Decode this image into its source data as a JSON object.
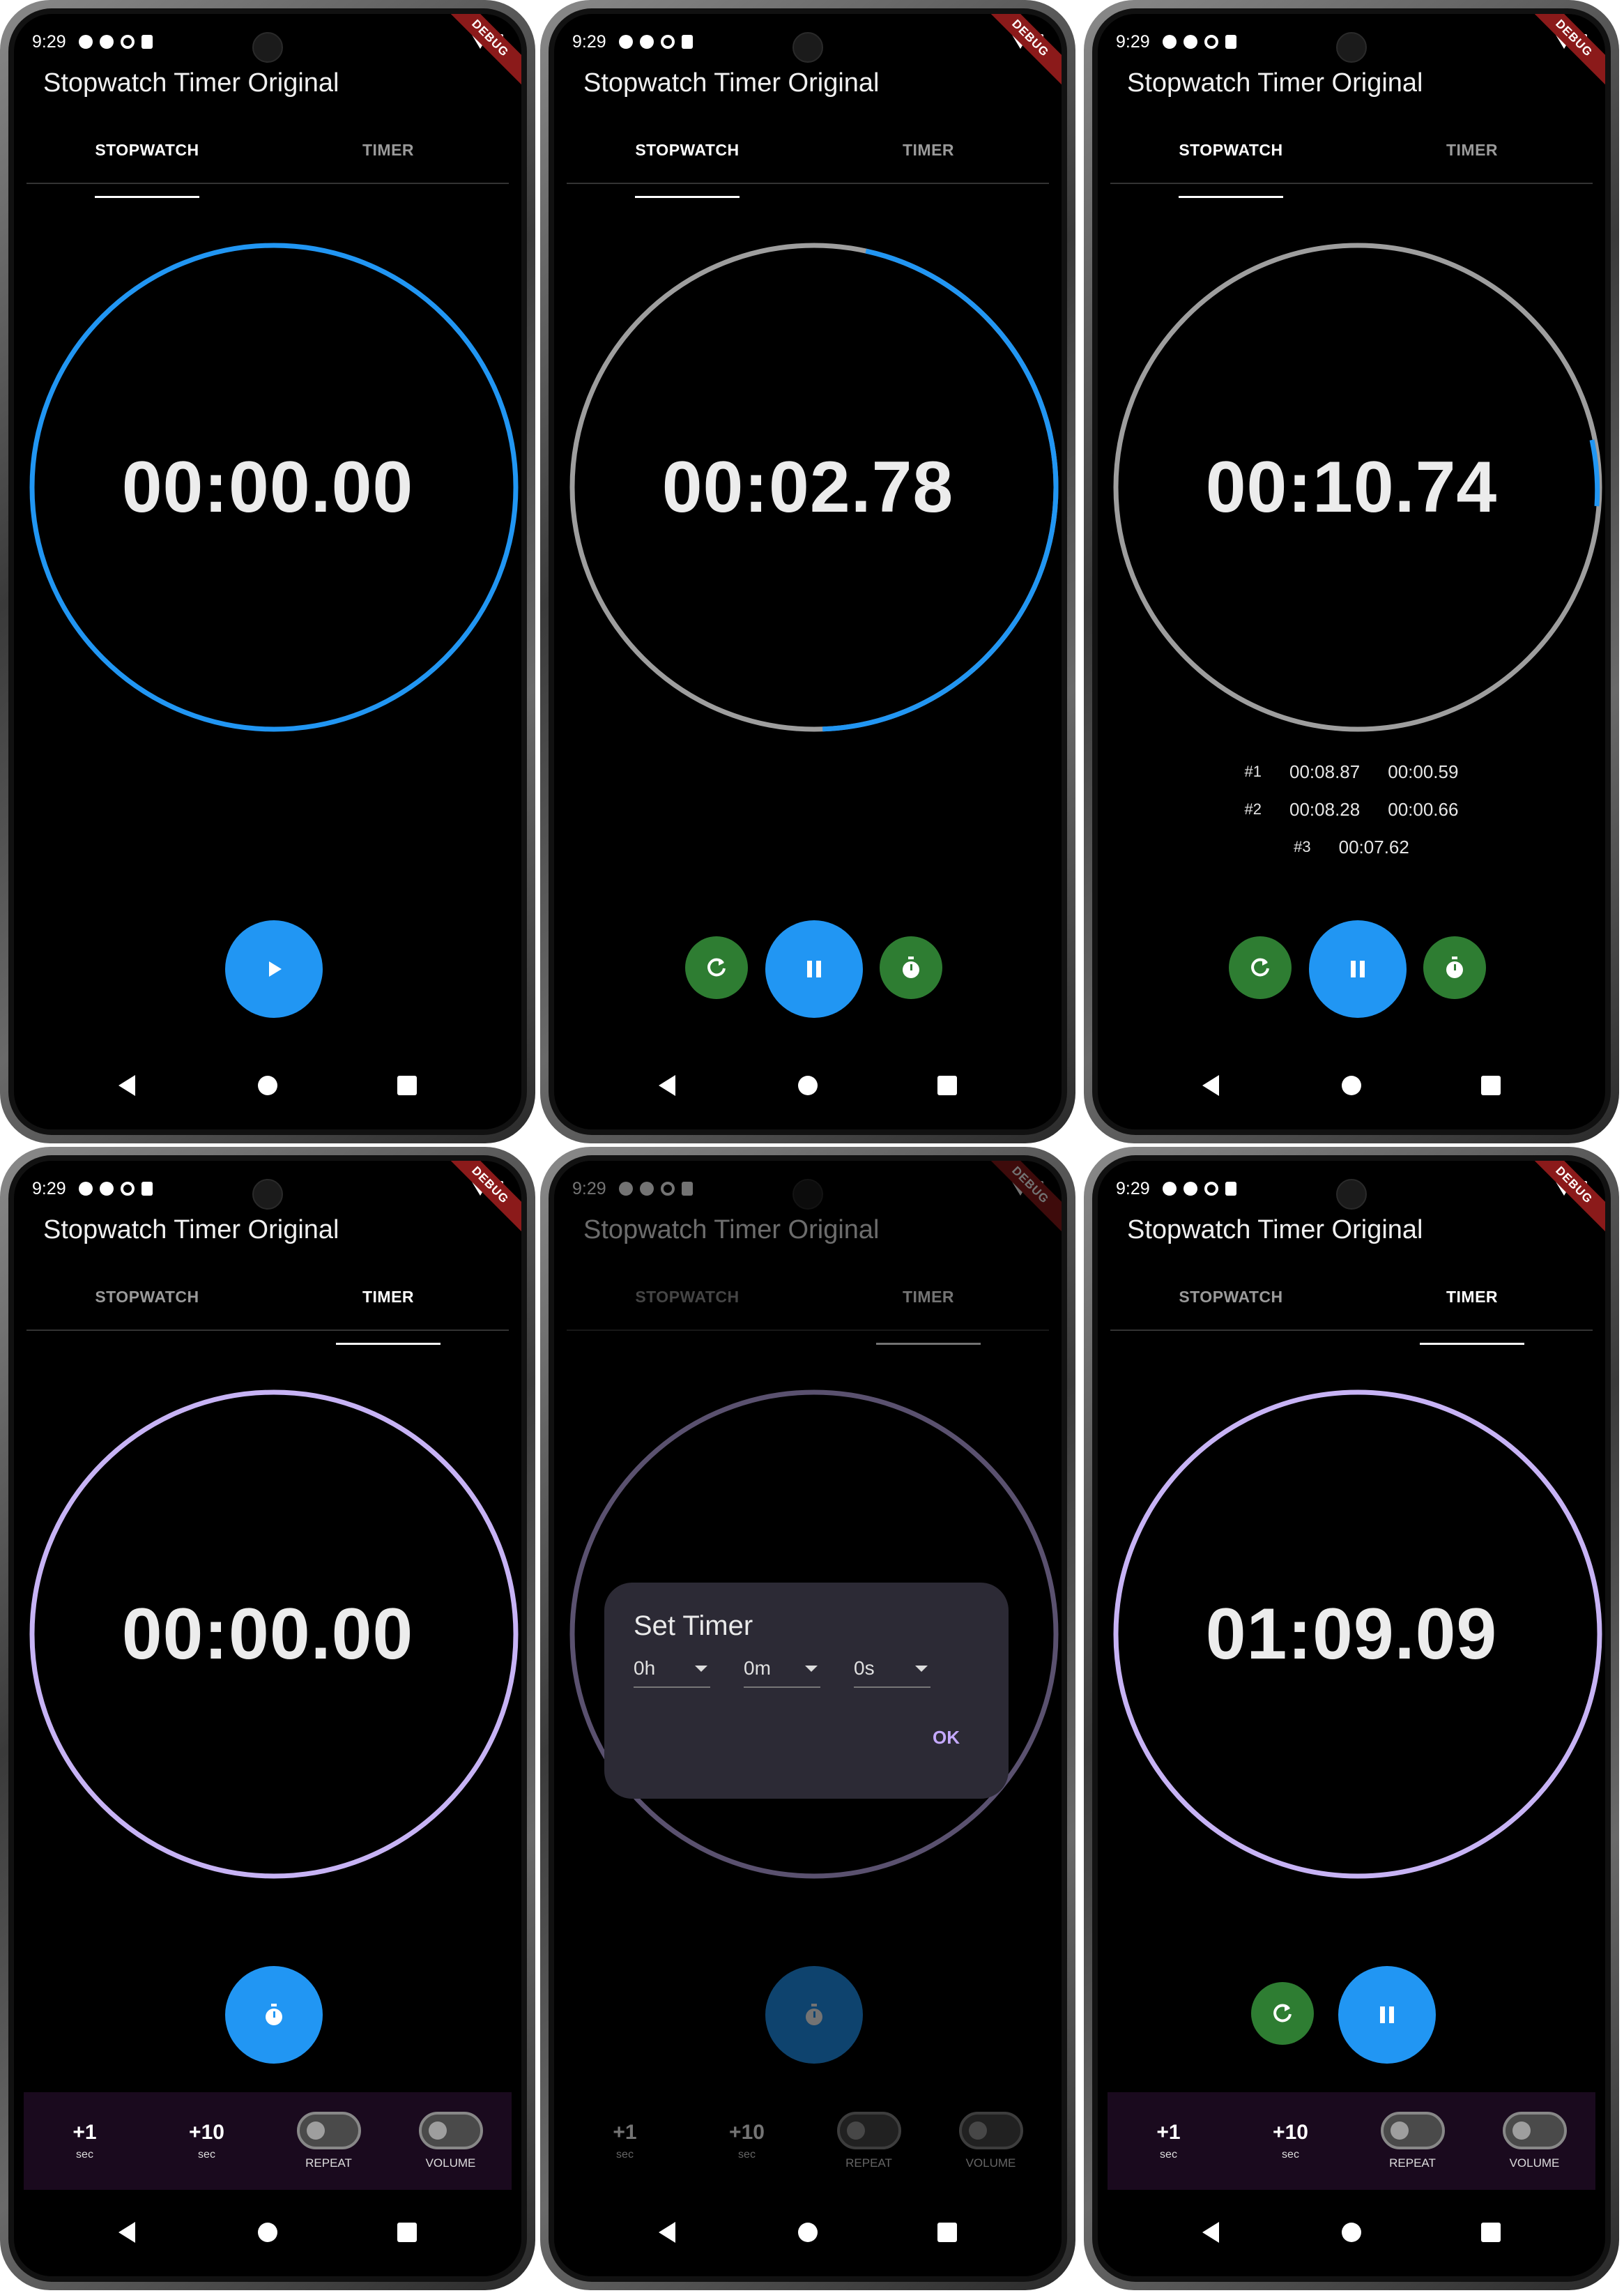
{
  "app_title": "Stopwatch Timer Original",
  "status_time": "9:29",
  "debug_label": "DEBUG",
  "tabs": {
    "stopwatch": "STOPWATCH",
    "timer": "TIMER"
  },
  "colors": {
    "accent_blue": "#2196f3",
    "lap_green": "#2e7d32",
    "timer_ring": "#c7b3f5",
    "track_gray": "#9e9e9e"
  },
  "screens": [
    {
      "active_tab": "stopwatch",
      "time": "00:00.00",
      "progress": 1.0
    },
    {
      "active_tab": "stopwatch",
      "time": "00:02.78",
      "progress": 0.46
    },
    {
      "active_tab": "stopwatch",
      "time": "00:10.74",
      "progress": 0.04,
      "laps": [
        {
          "num": "#1",
          "total": "00:08.87",
          "split": "00:00.59"
        },
        {
          "num": "#2",
          "total": "00:08.28",
          "split": "00:00.66"
        },
        {
          "num": "#3",
          "total": "00:07.62",
          "split": ""
        }
      ]
    },
    {
      "active_tab": "timer",
      "time": "00:00.00"
    },
    {
      "active_tab": "timer",
      "time": ""
    },
    {
      "active_tab": "timer",
      "time": "01:09.09"
    }
  ],
  "timer_bar": {
    "plus1": "+1",
    "plus10": "+10",
    "sec": "sec",
    "repeat": "REPEAT",
    "volume": "VOLUME"
  },
  "set_timer_dialog": {
    "title": "Set Timer",
    "hours": "0h",
    "minutes": "0m",
    "seconds": "0s",
    "ok": "OK"
  }
}
